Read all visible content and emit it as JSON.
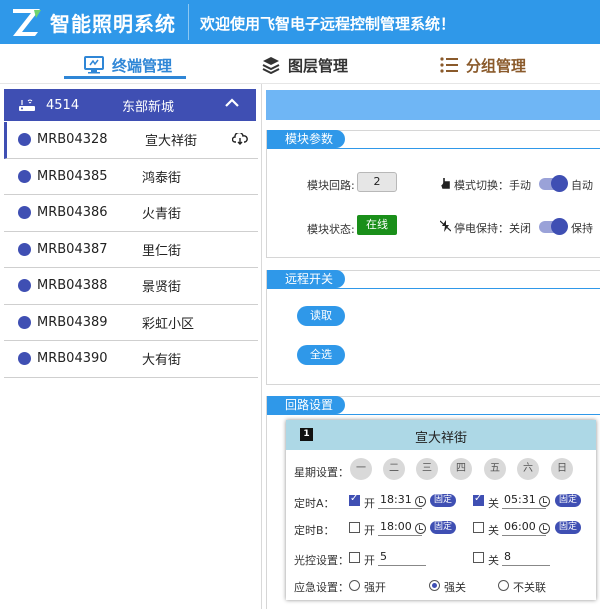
{
  "header": {
    "app_title": "智能照明系统",
    "welcome": "欢迎使用飞智电子远程控制管理系统！"
  },
  "nav": {
    "tabs": [
      {
        "label": "终端管理",
        "icon": "terminal-icon",
        "active": true
      },
      {
        "label": "图层管理",
        "icon": "layers-icon",
        "active": false
      },
      {
        "label": "分组管理",
        "icon": "list-icon",
        "active": false
      }
    ]
  },
  "sidebar": {
    "group": {
      "id": "4514",
      "name": "东部新城"
    },
    "devices": [
      {
        "id": "MRB04328",
        "name": "宣大祥街",
        "selected": true
      },
      {
        "id": "MRB04385",
        "name": "鸿泰街"
      },
      {
        "id": "MRB04386",
        "name": "火青街"
      },
      {
        "id": "MRB04387",
        "name": "里仁街"
      },
      {
        "id": "MRB04388",
        "name": "景贤街"
      },
      {
        "id": "MRB04389",
        "name": "彩虹小区"
      },
      {
        "id": "MRB04390",
        "name": "大有街"
      }
    ]
  },
  "module_params": {
    "title": "模块参数",
    "loop_label": "模块回路:",
    "loop_value": "2",
    "status_label": "模块状态:",
    "status_value": "在线",
    "mode_label": "模式切换：手动",
    "mode_on": "自动",
    "power_label": "停电保持：关闭",
    "power_on": "保持"
  },
  "remote_switch": {
    "title": "远程开关",
    "read_button": "读取",
    "select_all_button": "全选"
  },
  "loop_settings": {
    "title": "回路设置",
    "card": {
      "number": "1",
      "title": "宣大祥街",
      "week_label": "星期设置：",
      "days": [
        "一",
        "二",
        "三",
        "四",
        "五",
        "六",
        "日"
      ],
      "timer_a_label": "定时A：",
      "timer_a_on_label": "开",
      "timer_a_on_time": "18:31",
      "timer_a_off_label": "关",
      "timer_a_off_time": "05:31",
      "timer_b_label": "定时B：",
      "timer_b_on_label": "开",
      "timer_b_on_time": "18:00",
      "timer_b_off_label": "关",
      "timer_b_off_time": "06:00",
      "fixed_label": "固定",
      "light_label": "光控设置：",
      "light_on_label": "开",
      "light_on_value": "5",
      "light_off_label": "关",
      "light_off_value": "8",
      "emergency_label": "应急设置：",
      "emergency_options": [
        "强开",
        "强关",
        "不关联"
      ],
      "emergency_selected": "强关"
    }
  },
  "colors": {
    "header_blue": "#2f98e9",
    "indigo": "#3f4fb3",
    "online_green": "#1a8f1a",
    "card_head": "#add8e6"
  }
}
